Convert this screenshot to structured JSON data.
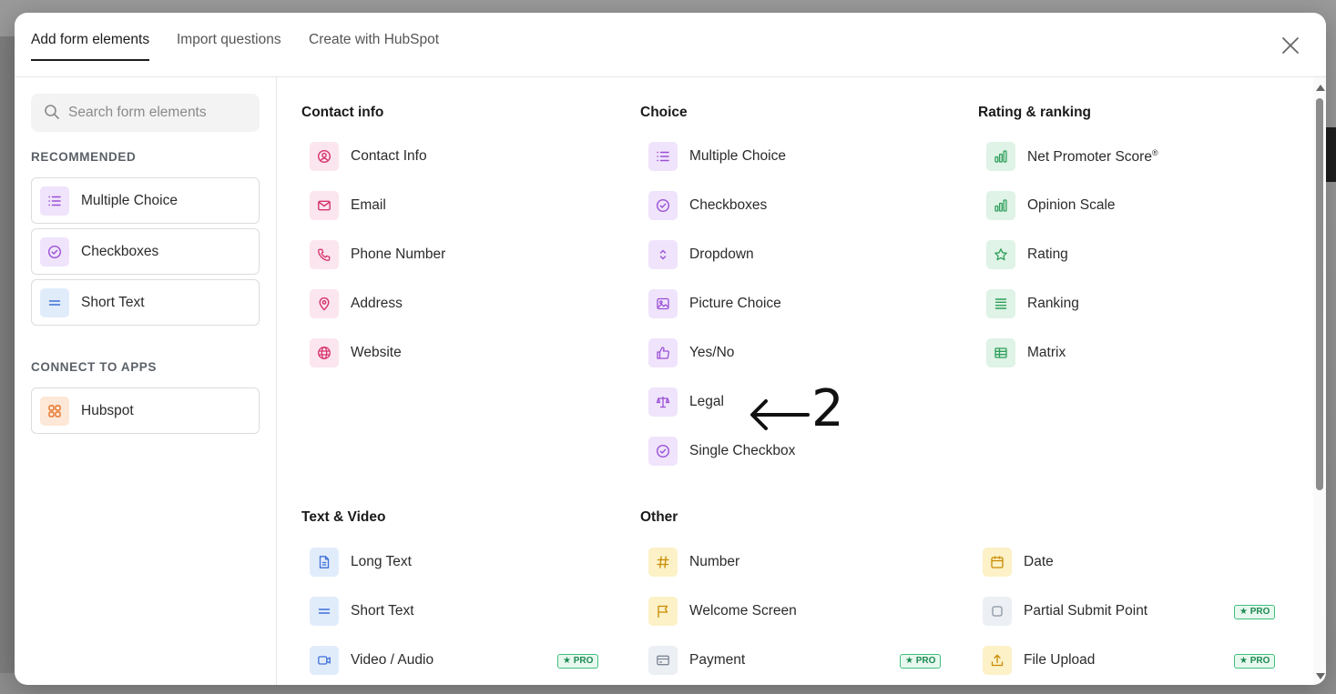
{
  "tabs": [
    {
      "label": "Add form elements",
      "active": true
    },
    {
      "label": "Import questions",
      "active": false
    },
    {
      "label": "Create with HubSpot",
      "active": false
    }
  ],
  "search": {
    "placeholder": "Search form elements",
    "value": ""
  },
  "sidebar": {
    "recommended_heading": "RECOMMENDED",
    "recommended": [
      {
        "label": "Multiple Choice",
        "icon": "list-icon",
        "color": "#efe4fb"
      },
      {
        "label": "Checkboxes",
        "icon": "check-circle-icon",
        "color": "#efe4fb"
      },
      {
        "label": "Short Text",
        "icon": "short-text-icon",
        "color": "#e1ecfb"
      }
    ],
    "apps_heading": "CONNECT TO APPS",
    "apps": [
      {
        "label": "Hubspot",
        "icon": "apps-grid-icon",
        "color": "#fde7d6"
      }
    ]
  },
  "sections": {
    "contact": {
      "title": "Contact info",
      "items": [
        {
          "label": "Contact Info",
          "icon": "user-circle-icon"
        },
        {
          "label": "Email",
          "icon": "mail-icon"
        },
        {
          "label": "Phone Number",
          "icon": "phone-icon"
        },
        {
          "label": "Address",
          "icon": "map-pin-icon"
        },
        {
          "label": "Website",
          "icon": "globe-icon"
        }
      ]
    },
    "choice": {
      "title": "Choice",
      "items": [
        {
          "label": "Multiple Choice",
          "icon": "list-icon"
        },
        {
          "label": "Checkboxes",
          "icon": "check-circle-icon"
        },
        {
          "label": "Dropdown",
          "icon": "chevron-updown-icon"
        },
        {
          "label": "Picture Choice",
          "icon": "image-icon"
        },
        {
          "label": "Yes/No",
          "icon": "thumbs-up-icon"
        },
        {
          "label": "Legal",
          "icon": "scale-icon"
        },
        {
          "label": "Single Checkbox",
          "icon": "check-circle-icon"
        }
      ]
    },
    "rating": {
      "title": "Rating & ranking",
      "items": [
        {
          "label": "Net Promoter Score",
          "sup": "®",
          "icon": "bar-chart-icon"
        },
        {
          "label": "Opinion Scale",
          "icon": "bar-chart-icon"
        },
        {
          "label": "Rating",
          "icon": "star-icon"
        },
        {
          "label": "Ranking",
          "icon": "ranking-icon"
        },
        {
          "label": "Matrix",
          "icon": "table-icon"
        }
      ]
    },
    "textvideo": {
      "title": "Text & Video",
      "items": [
        {
          "label": "Long Text",
          "icon": "document-icon"
        },
        {
          "label": "Short Text",
          "icon": "short-text-icon"
        },
        {
          "label": "Video / Audio",
          "icon": "video-icon",
          "pro": "★ PRO"
        }
      ]
    },
    "other": {
      "title": "Other",
      "col1": [
        {
          "label": "Number",
          "icon": "hash-icon"
        },
        {
          "label": "Welcome Screen",
          "icon": "flag-icon"
        },
        {
          "label": "Payment",
          "icon": "credit-card-icon",
          "pro": "★ PRO"
        }
      ],
      "col2": [
        {
          "label": "Date",
          "icon": "calendar-icon"
        },
        {
          "label": "Partial Submit Point",
          "icon": "square-icon",
          "pro": "★ PRO"
        },
        {
          "label": "File Upload",
          "icon": "upload-icon",
          "pro": "★ PRO"
        }
      ]
    }
  },
  "annotation": {
    "number": "2"
  },
  "colors": {
    "contact": "#fbe5ee",
    "choice": "#efe4fb",
    "rating": "#dff3e6",
    "text": "#e1ecfb",
    "other": "#fcf1c7",
    "pro_badge": "#1d8a52"
  }
}
